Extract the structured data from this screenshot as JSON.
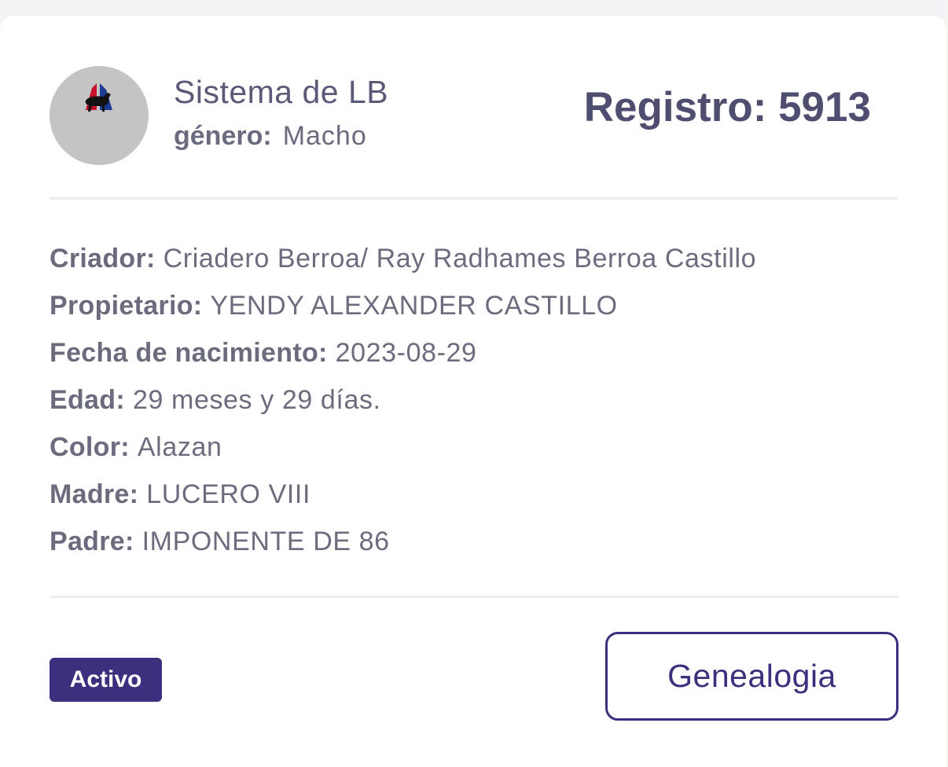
{
  "header": {
    "org_name": "Sistema de LB",
    "gender_label": "género:",
    "gender_value": "Macho",
    "registro": "Registro: 5913",
    "logo_icon": "horse-flag-logo-icon"
  },
  "details": [
    {
      "label": "Criador:",
      "value": "Criadero Berroa/ Ray Radhames Berroa Castillo"
    },
    {
      "label": "Propietario:",
      "value": "YENDY ALEXANDER CASTILLO"
    },
    {
      "label": "Fecha de nacimiento:",
      "value": "2023-08-29"
    },
    {
      "label": "Edad:",
      "value": "29 meses y 29 días."
    },
    {
      "label": "Color:",
      "value": "Alazan"
    },
    {
      "label": "Madre:",
      "value": "LUCERO VIII"
    },
    {
      "label": "Padre:",
      "value": "IMPONENTE DE 86"
    }
  ],
  "footer": {
    "status_badge": "Activo",
    "genealogy_button": "Genealogia"
  },
  "colors": {
    "accent": "#3b2f7e",
    "title": "#4f4e70",
    "text": "#6c6c7e",
    "avatar_bg": "#c4c4c4"
  }
}
